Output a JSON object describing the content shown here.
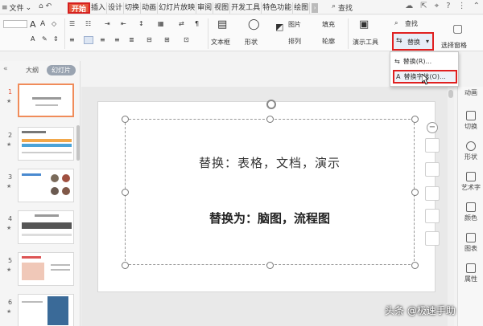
{
  "menu": {
    "file": "文件",
    "tabs": [
      "开始",
      "插入",
      "设计",
      "切换",
      "动画",
      "幻灯片放映",
      "审阅",
      "视图",
      "开发工具",
      "特色功能",
      "绘图"
    ],
    "search": "查找"
  },
  "ribbon": {
    "textbox": "文本框",
    "shape": "形状",
    "image": "图片",
    "fill": "填充",
    "arrange": "排列",
    "outline": "轮廓",
    "present_tool": "演示工具",
    "find": "查找",
    "replace": "替换",
    "select_pane": "选择窗格"
  },
  "dropdown": {
    "items": [
      "替换(R)...",
      "替换字体(O)..."
    ]
  },
  "left_panel": {
    "tab_outline": "大纲",
    "tab_slides": "幻灯片",
    "slide_numbers": [
      "1",
      "2",
      "3",
      "4",
      "5",
      "6"
    ]
  },
  "slide": {
    "line1": "替换：表格，文档，演示",
    "line2": "替换为：脑图，流程图"
  },
  "right_sidebar": {
    "items": [
      "动画",
      "切换",
      "形状",
      "艺术字",
      "颜色",
      "图表",
      "属性"
    ]
  },
  "watermark": "头条 @极速手助",
  "colors": {
    "active_tab": "#e5553a",
    "highlight_border": "#e02020",
    "selected_thumb": "#f08c5a"
  }
}
